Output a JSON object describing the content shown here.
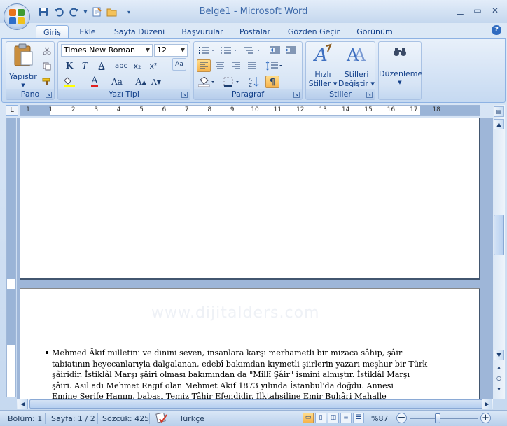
{
  "window": {
    "title": "Belge1 - Microsoft Word"
  },
  "quick_access": [
    "save-icon",
    "undo-icon",
    "redo-icon",
    "new-icon",
    "open-icon",
    "customize-icon"
  ],
  "tabs": [
    {
      "label": "Giriş",
      "active": true
    },
    {
      "label": "Ekle"
    },
    {
      "label": "Sayfa Düzeni"
    },
    {
      "label": "Başvurular"
    },
    {
      "label": "Postalar"
    },
    {
      "label": "Gözden Geçir"
    },
    {
      "label": "Görünüm"
    }
  ],
  "ribbon": {
    "pano": {
      "label": "Pano",
      "paste": "Yapıştır"
    },
    "font": {
      "label": "Yazı Tipi",
      "name": "Times New Roman",
      "size": "12"
    },
    "paragraph": {
      "label": "Paragraf"
    },
    "styles": {
      "label": "Stiller",
      "quick": "Hızlı",
      "quick2": "Stiller",
      "change": "Stilleri",
      "change2": "Değiştir"
    },
    "editing": {
      "label": "Düzenleme"
    }
  },
  "ruler": {
    "marks": [
      "1",
      "1",
      "2",
      "3",
      "4",
      "5",
      "6",
      "7",
      "8",
      "9",
      "10",
      "11",
      "12",
      "13",
      "14",
      "15",
      "16",
      "17",
      "18"
    ]
  },
  "document": {
    "watermark": "www.dijitalders.com",
    "lines": [
      "Mehmed Âkif milletini ve dinini seven, insanlara karşı merhametli bir mizaca sâhip, şâir",
      "tabiatının heyecanlarıyla dalgalanan, edebî bakımdan kıymetli şiirlerin yazarı meşhur bir Türk",
      "şâiridir. İstiklâl Marşı şâiri olması bakımından da \"Millî Şâir\" ismini almıştır. İstiklâl Marşı",
      "şâiri. Asıl adı Mehmet Ragıf olan Mehmet Akif 1873 yılında İstanbul'da doğdu. Annesi",
      "Emine Şerife Hanım, babası Temiz Tâhir Efendidir. İlktahsiline Emir Buhâri Mahalle"
    ]
  },
  "statusbar": {
    "section": "Bölüm: 1",
    "page": "Sayfa: 1 / 2",
    "words": "Sözcük: 425",
    "language": "Türkçe",
    "zoom": "%87"
  },
  "colors": {
    "accent": "#15428b",
    "ribbon": "#d0e0f4",
    "active_button": "#f7b34b"
  }
}
